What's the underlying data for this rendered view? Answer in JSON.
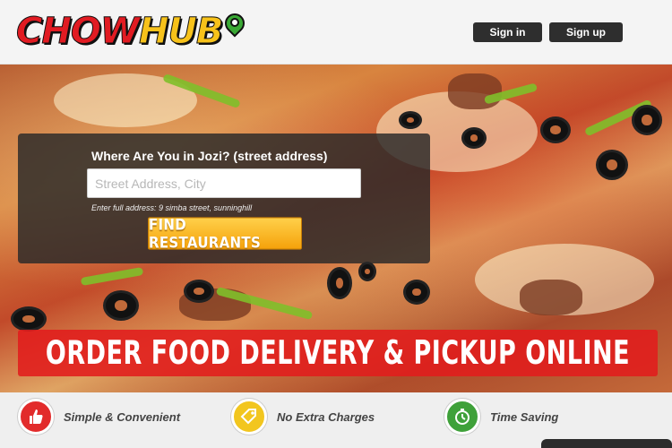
{
  "brand": {
    "name_part1": "CHOW",
    "name_part2": "HUB"
  },
  "header": {
    "signin_label": "Sign in",
    "signup_label": "Sign up"
  },
  "search": {
    "label": "Where Are You in Jozi? (street address)",
    "placeholder": "Street Address, City",
    "value": "",
    "hint": "Enter full address: 9 simba street, sunninghill",
    "button_label": "FIND RESTAURANTS"
  },
  "banner": {
    "text": "ORDER FOOD DELIVERY & PICKUP ONLINE"
  },
  "features": [
    {
      "label": "Simple & Convenient",
      "icon": "thumbs-up-icon",
      "color": "#e22b2b"
    },
    {
      "label": "No Extra Charges",
      "icon": "price-tag-icon",
      "color": "#f2c61f"
    },
    {
      "label": "Time Saving",
      "icon": "stopwatch-icon",
      "color": "#3fa13a"
    }
  ],
  "colors": {
    "brand_red": "#e11b22",
    "brand_yellow": "#f7c21a",
    "button_orange": "#f5a20b",
    "banner_red": "#e11c1c"
  }
}
